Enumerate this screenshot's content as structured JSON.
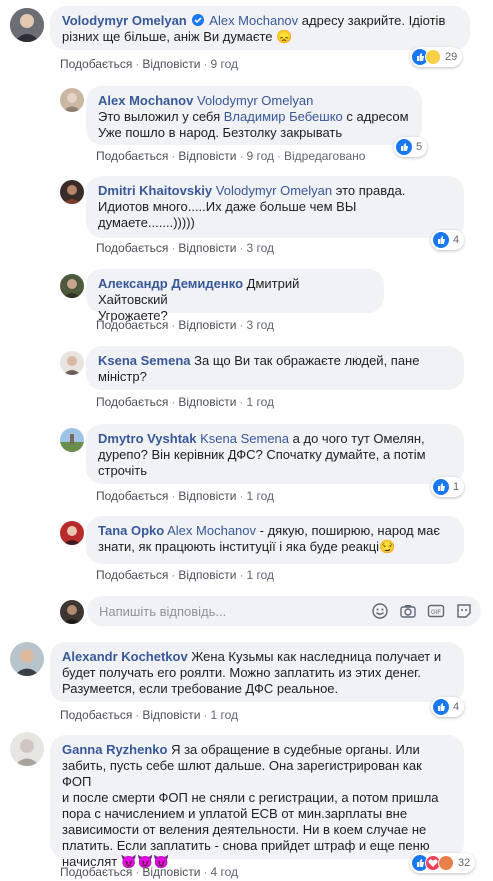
{
  "comments": [
    {
      "author": "Volodymyr Omelyan",
      "mention": "Alex Mochanov",
      "text": "адресу закрийте. Ідіотів різних ще більше, аніж Ви думаєте",
      "like": "Подобається",
      "reply": "Відповісти",
      "time": "9 год",
      "reactions_count": "29"
    },
    {
      "author": "Alex Mochanov",
      "mention": "Volodymyr Omelyan",
      "line1": "Это выложил у себя",
      "mention2": "Владимир Бебешко",
      "line1b": "с адресом",
      "line2": "Уже пошло в народ. Безтолку закрывать",
      "like": "Подобається",
      "reply": "Відповісти",
      "time": "9 год",
      "edited": "Відредаговано",
      "reactions_count": "5"
    },
    {
      "author": "Dmitri Khaitovskiy",
      "mention": "Volodymyr Omelyan",
      "line1": "это правда.",
      "line2": "Идиотов много.....Их даже больше чем ВЫ",
      "line3": "думаете.......)))))",
      "like": "Подобається",
      "reply": "Відповісти",
      "time": "3 год",
      "reactions_count": "4"
    },
    {
      "author": "Александр Демиденко",
      "line1": "Дмитрий Хайтовский",
      "line2": "Угрожаете?",
      "like": "Подобається",
      "reply": "Відповісти",
      "time": "3 год"
    },
    {
      "author": "Ksena Semena",
      "line1": "За що Ви так ображаєте людей, пане",
      "line2": "міністр?",
      "like": "Подобається",
      "reply": "Відповісти",
      "time": "1 год"
    },
    {
      "author": "Dmytro Vyshtak",
      "mention": "Ksena Semena",
      "line1": "а до чого тут Омелян,",
      "line2": "дурепо? Він керівник ДФС? Спочатку думайте, а потім",
      "line3": "строчіть",
      "like": "Подобається",
      "reply": "Відповісти",
      "time": "1 год",
      "reactions_count": "1"
    },
    {
      "author": "Tana Opko",
      "mention": "Alex Mochanov",
      "line1": "- дякую, поширюю, народ має",
      "line2": "знати, як працюють інституції і яка буде реакці",
      "like": "Подобається",
      "reply": "Відповісти",
      "time": "1 год"
    },
    {
      "author": "Alexandr Kochetkov",
      "line1": "Жена Кузьмы как наследница получает и",
      "line2": "будет получать его роялти. Можно заплатить из этих денег.",
      "line3": "Разумеется, если требование ДФС реальное.",
      "like": "Подобається",
      "reply": "Відповісти",
      "time": "1 год",
      "reactions_count": "4"
    },
    {
      "author": "Ganna Ryzhenko",
      "line1": "Я за обращение в судебные органы. Или",
      "line2": "забить, пусть себе шлют дальше. Она зарегистрирован как ФОП",
      "line3": "и после смерти ФОП не сняли с регистрации, а потом пришла",
      "line4": "пора с начислением и уплатой ЕСВ от мин.зарплаты вне",
      "line5": "зависимости от веления деятельности. Ни в коем случае не",
      "line6": "платить. Если заплатить - снова прийдет штраф и еще пеню",
      "line7": "начислят",
      "like": "Подобається",
      "reply": "Відповісти",
      "time": "4 год",
      "reactions_count": "32"
    }
  ],
  "reply_box": {
    "placeholder": "Напишіть відповідь..."
  },
  "colors": {
    "link": "#385898",
    "bubble": "#f0f2f5",
    "like": "#1877f2"
  }
}
